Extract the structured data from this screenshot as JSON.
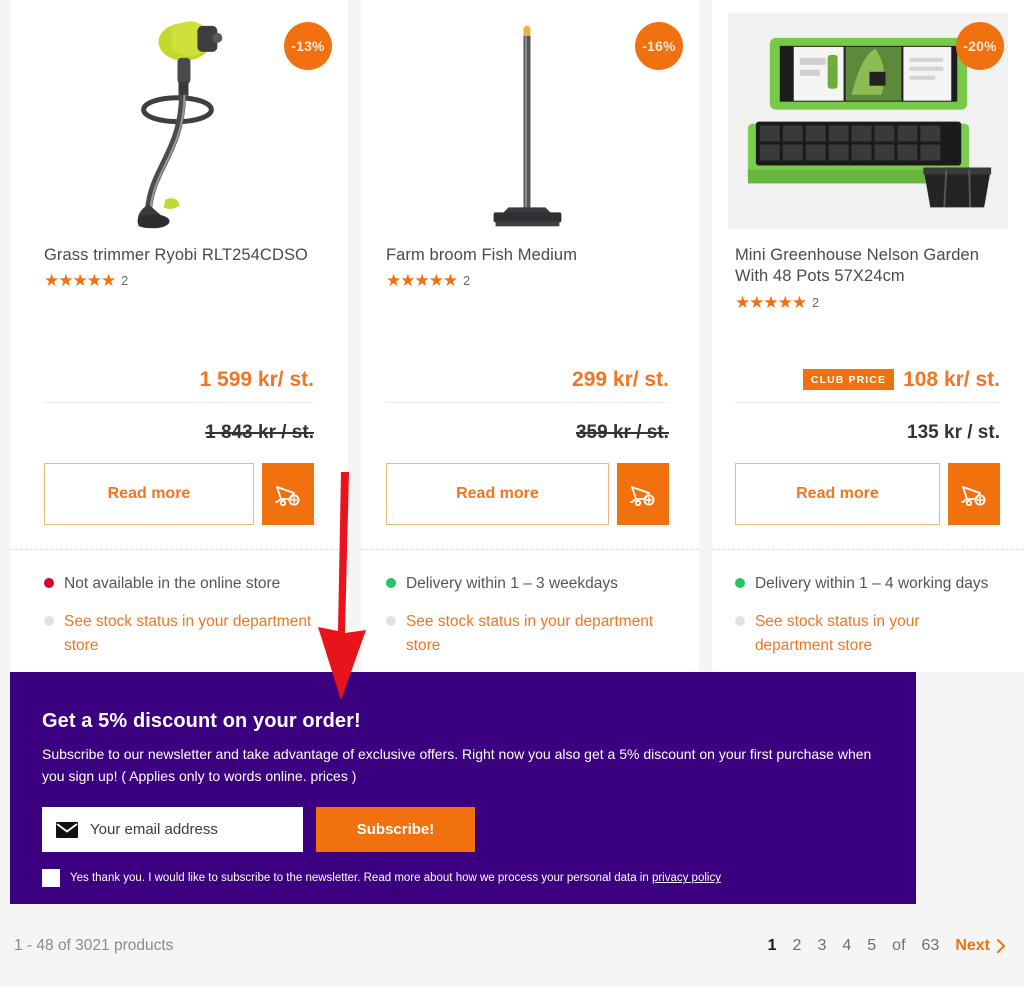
{
  "products": [
    {
      "name": "Grass trimmer Ryobi RLT254CDSO",
      "discount": "-13%",
      "stars": "★★★★★",
      "review_count": "2",
      "price": "1 599 kr/ st.",
      "old_price": "1 843 kr / st.",
      "club_label": null,
      "read_more": "Read more",
      "stock_status": "Not available in the online store",
      "stock_dot": "red",
      "stock_link": "See stock status in your department store",
      "image": "grass-trimmer"
    },
    {
      "name": "Farm broom Fish Medium",
      "discount": "-16%",
      "stars": "★★★★★",
      "review_count": "2",
      "price": "299 kr/ st.",
      "old_price": "359 kr / st.",
      "club_label": null,
      "read_more": "Read more",
      "stock_status": "Delivery within 1 – 3 weekdays",
      "stock_dot": "green",
      "stock_link": "See stock status in your department store",
      "image": "farm-broom"
    },
    {
      "name": "Mini Greenhouse Nelson Garden With 48 Pots 57X24cm",
      "discount": "-20%",
      "stars": "★★★★★",
      "review_count": "2",
      "price": "108 kr/ st.",
      "old_price": "135 kr / st.",
      "club_label": "CLUB PRICE",
      "read_more": "Read more",
      "stock_status": "Delivery within 1 – 4 working days",
      "stock_dot": "green",
      "stock_link": "See stock status in your department store",
      "image": "mini-greenhouse"
    }
  ],
  "newsletter": {
    "heading": "Get a 5% discount on your order!",
    "body": "Subscribe to our newsletter and take advantage of exclusive offers. Right now you also get a 5% discount on your first purchase when you sign up! ( Applies only to words online. prices )",
    "email_placeholder": "Your email address",
    "email_value": "",
    "subscribe_label": "Subscribe!",
    "consent_text": "Yes thank you. I would like to subscribe to the newsletter. Read more about how we process your personal data in ",
    "consent_link": "privacy policy",
    "checkbox_checked": false
  },
  "footer": {
    "result_count": "1 - 48 of 3021 products",
    "pages": [
      "1",
      "2",
      "3",
      "4",
      "5"
    ],
    "active_page": "1",
    "of_label": "of",
    "last_page": "63",
    "next_label": "Next"
  },
  "colors": {
    "brand_orange": "#f2710f",
    "price_orange": "#ee7624",
    "banner_purple": "#3b0080",
    "in_stock_green": "#22c55e",
    "out_of_stock_red": "#d80027",
    "annotation_red": "#e8141c"
  }
}
